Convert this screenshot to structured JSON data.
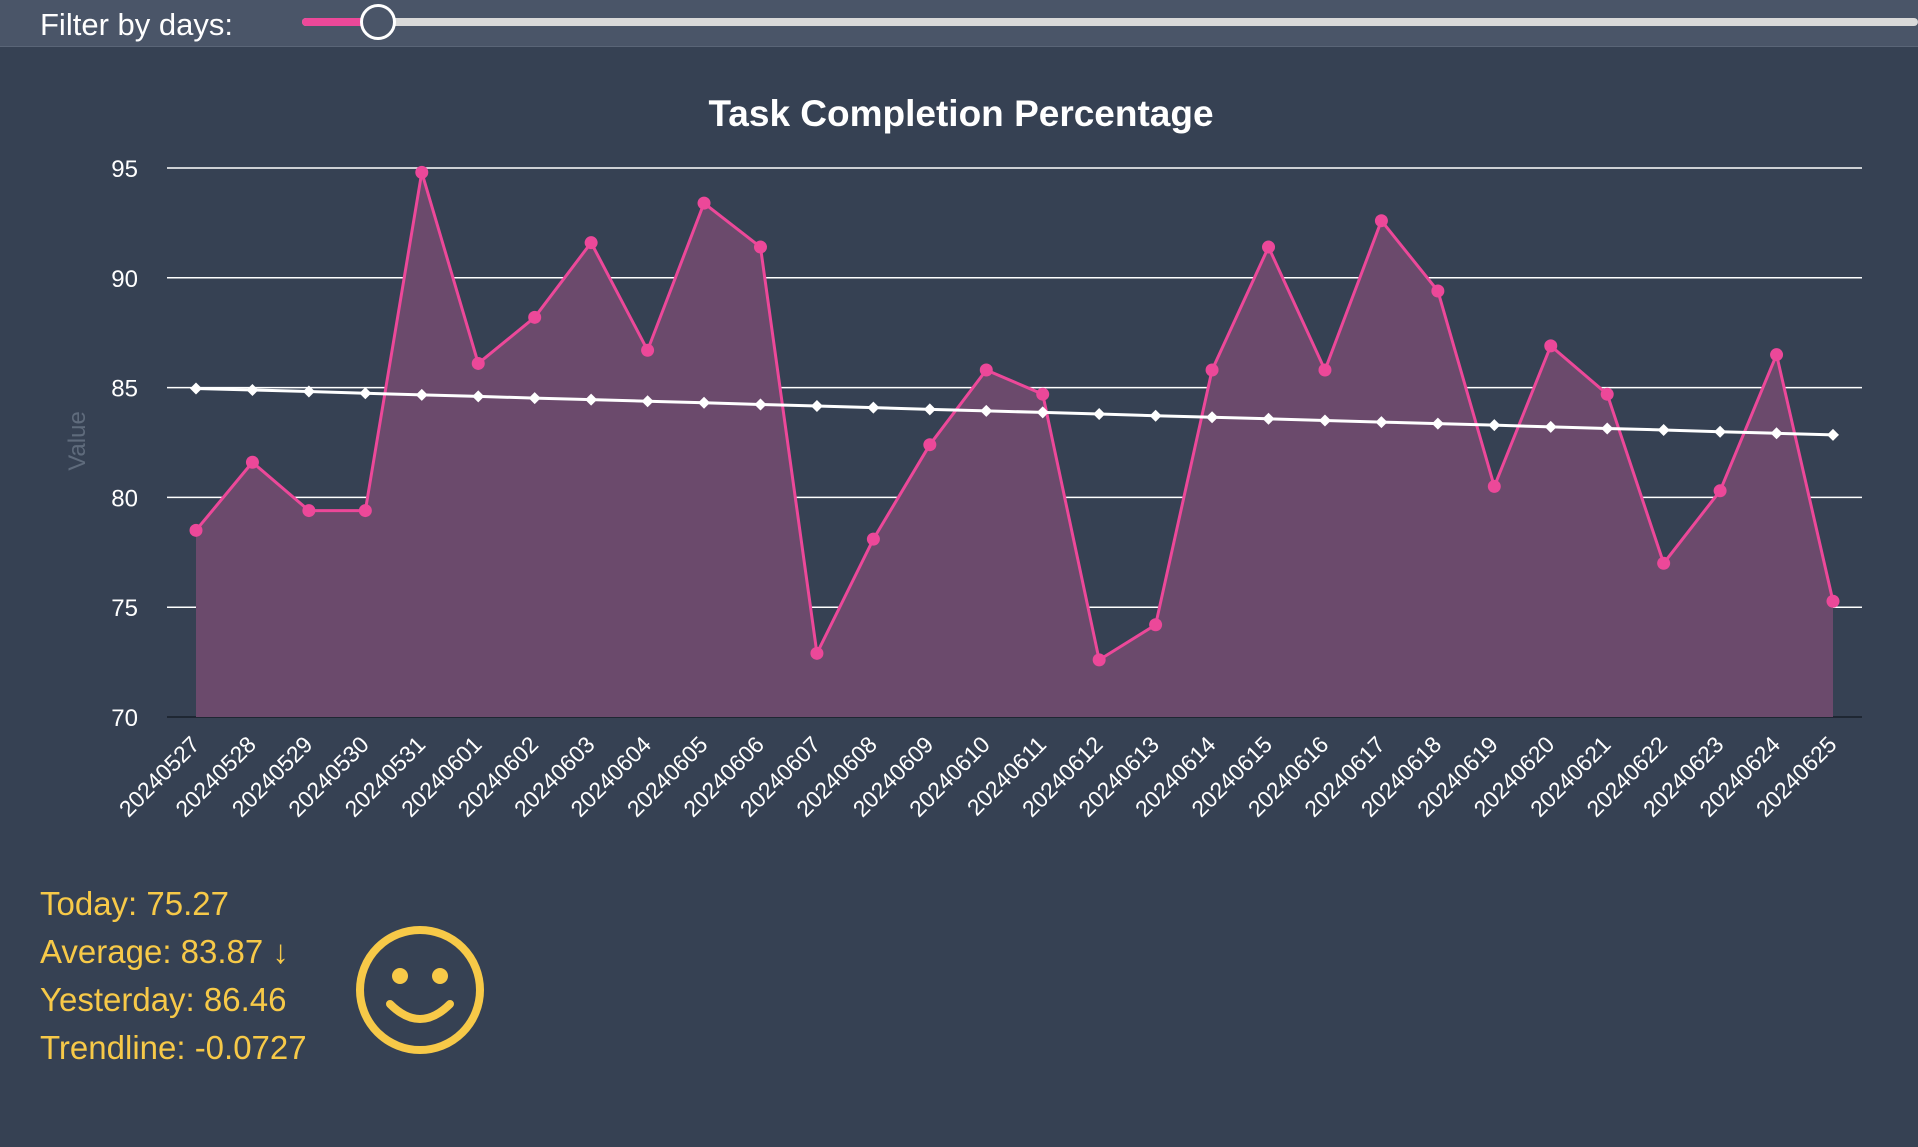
{
  "filter": {
    "label": "Filter by days:",
    "value_fraction": 0.047
  },
  "colors": {
    "accent": "#ec4899",
    "area": "#6b4a6c",
    "trend": "#ffffff",
    "stats": "#f7c948",
    "background": "#364153"
  },
  "chart_data": {
    "type": "area",
    "title": "Task Completion Percentage",
    "xlabel": "",
    "ylabel": "Value",
    "ylim": [
      70,
      95
    ],
    "yticks": [
      70,
      75,
      80,
      85,
      90,
      95
    ],
    "grid": true,
    "categories": [
      "20240527",
      "20240528",
      "20240529",
      "20240530",
      "20240531",
      "20240601",
      "20240602",
      "20240603",
      "20240604",
      "20240605",
      "20240606",
      "20240607",
      "20240608",
      "20240609",
      "20240610",
      "20240611",
      "20240612",
      "20240613",
      "20240614",
      "20240615",
      "20240616",
      "20240617",
      "20240618",
      "20240619",
      "20240620",
      "20240621",
      "20240622",
      "20240623",
      "20240624",
      "20240625"
    ],
    "series": [
      {
        "values": [
          78.5,
          81.6,
          79.4,
          79.4,
          94.8,
          86.1,
          88.2,
          91.6,
          86.7,
          93.4,
          91.4,
          72.9,
          78.1,
          82.4,
          85.8,
          84.7,
          72.6,
          74.2,
          85.8,
          91.4,
          85.8,
          92.6,
          89.4,
          80.5,
          86.9,
          84.7,
          77.0,
          80.3,
          86.5,
          75.27
        ]
      },
      {
        "values": [
          84.96,
          84.89,
          84.82,
          84.74,
          84.67,
          84.6,
          84.52,
          84.45,
          84.38,
          84.31,
          84.23,
          84.16,
          84.09,
          84.01,
          83.94,
          83.87,
          83.8,
          83.72,
          83.65,
          83.58,
          83.5,
          83.43,
          83.36,
          83.29,
          83.21,
          83.14,
          83.07,
          82.99,
          82.92,
          82.85
        ]
      }
    ]
  },
  "stats": {
    "today": "Today: 75.27",
    "average": "Average: 83.87 ↓",
    "yesterday": "Yesterday: 86.46",
    "trendline": "Trendline: -0.0727"
  },
  "mood_icon": "smiley-face-icon"
}
